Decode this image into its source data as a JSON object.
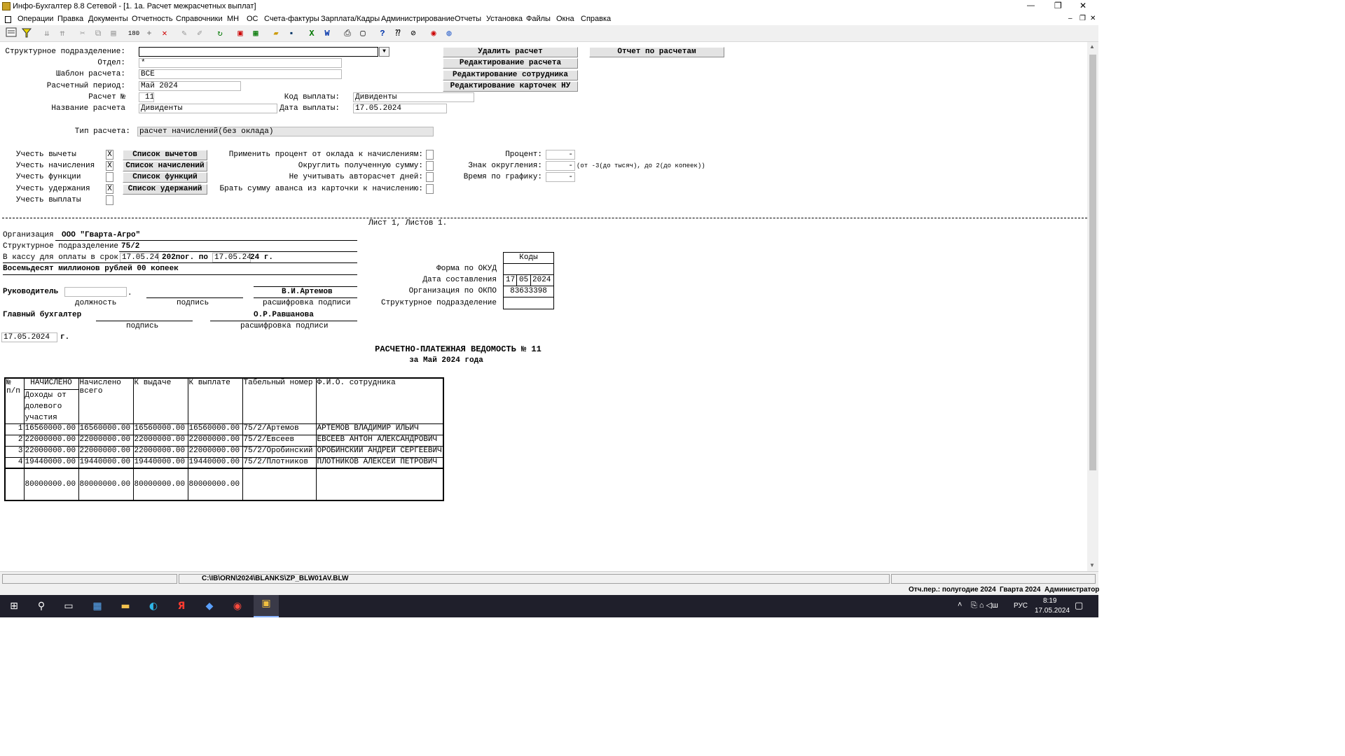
{
  "window": {
    "title": "Инфо-Бухгалтер 8.8 Сетевой - [1. 1а. Расчет межрасчетных выплат]",
    "minimize": "—",
    "restore": "❐",
    "close": "✕"
  },
  "menu": [
    "Операции",
    "Правка",
    "Документы",
    "Отчетность",
    "Справочники",
    "МН",
    "ОС",
    "Счета-фактуры",
    "Зарплата/Кадры",
    "Администрирование",
    "Отчеты",
    "Установка",
    "Файлы",
    "Окна",
    "Справка"
  ],
  "form": {
    "struct_label": "Структурное подразделение:",
    "struct_value": "",
    "otdel_label": "Отдел:",
    "otdel_value": "*",
    "template_label": "Шаблон расчета:",
    "template_value": "ВСЕ",
    "period_label": "Расчетный период:",
    "period_value": "Май 2024",
    "calc_no_label": "Расчет №",
    "calc_no_value": "11",
    "code_label": "Код выплаты:",
    "code_value": "Дивиденты",
    "calc_name_label": "Название расчета",
    "calc_name_value": "Дивиденты",
    "pay_date_label": "Дата выплаты:",
    "pay_date_value": "17.05.2024",
    "type_label": "Тип расчета:",
    "type_value": "расчет начислений(без оклада)"
  },
  "buttons": {
    "delete": "Удалить расчет",
    "report": "Отчет по расчетам",
    "edit_calc": "Редактирование расчета",
    "edit_emp": "Редактирование сотрудника",
    "edit_cards": "Редактирование карточек НУ"
  },
  "options": {
    "deductions": {
      "label": "Учесть вычеты",
      "checked": "X",
      "button": "Список вычетов"
    },
    "accruals": {
      "label": "Учесть начисления",
      "checked": "X",
      "button": "Список начислений"
    },
    "functions": {
      "label": "Учесть функции",
      "checked": "",
      "button": "Список функций"
    },
    "withholdings": {
      "label": "Учесть удержания",
      "checked": "X",
      "button": "Список удержаний"
    },
    "payments": {
      "label": "Учесть выплаты",
      "checked": ""
    },
    "apply_percent": "Применить процент от оклада к начислениям:",
    "round_sum": "Округлить полученную сумму:",
    "no_autocalc": "Не учитывать авторасчет дней:",
    "take_advance": "Брать сумму аванса из карточки к начислению:",
    "percent_label": "Процент:",
    "percent_value": "-",
    "round_sign_label": "Знак округления:",
    "round_sign_value": "-",
    "round_hint": "(от -3(до тысяч), до 2(до копеек))",
    "schedule_label": "Время по графику:",
    "schedule_value": "-"
  },
  "doc": {
    "sheet": "Лист 1, Листов 1.",
    "org_label": "Организация",
    "org_value": "ООО \"Гварта-Агро\"",
    "struct_label": "Структурное подразделение",
    "struct_value": "75/2",
    "cash_label": "В кассу для оплаты в срок",
    "cash_from": "17.05.24",
    "cash_mid": "202пог. по",
    "cash_to": "17.05.24",
    "cash_end": "24 г.",
    "sum_words": "Восемьдесят миллионов рублей 00 копеек",
    "head_label": "Руководитель",
    "head_name": "В.И.Артемов",
    "cap_position": "должность",
    "cap_signature": "подпись",
    "cap_decode": "расшифровка подписи",
    "chief_label": "Главный бухгалтер",
    "chief_name": "О.Р.Равшанова",
    "cap_signature2": "подпись",
    "cap_decode2": "расшифровка подписи",
    "date_value": "17.05.2024",
    "date_suffix": "г.",
    "codes_header": "Коды",
    "okud_label": "Форма по ОКУД",
    "comp_date_label": "Дата составления",
    "comp_day": "17",
    "comp_month": "05",
    "comp_year": "2024",
    "okpo_label": "Организация по ОКПО",
    "okpo_value": "83633398",
    "struct_code_label": "Структурное подразделение",
    "title": "РАСЧЕТНО-ПЛАТЕЖНАЯ ВЕДОМОСТЬ № 11",
    "subtitle": "за Май 2024 года"
  },
  "table": {
    "headers": {
      "no": "№\nп/п",
      "accrued": "НАЧИСЛЕНО",
      "accrued_sub": "Доходы от\nдолевого\nучастия",
      "total": "Начислено\nвсего",
      "to_issue": "К выдаче",
      "to_pay": "К выплате",
      "tab_no": "Табельный номер",
      "fio": "Ф.И.О. сотрудника"
    },
    "rows": [
      {
        "no": "1",
        "income": "16560000.00",
        "total": "16560000.00",
        "issue": "16560000.00",
        "pay": "16560000.00",
        "tab": "75/2/Артемов",
        "fio": "АРТЕМОВ ВЛАДИМИР ИЛЬИЧ"
      },
      {
        "no": "2",
        "income": "22000000.00",
        "total": "22000000.00",
        "issue": "22000000.00",
        "pay": "22000000.00",
        "tab": "75/2/Евсеев",
        "fio": "ЕВСЕЕВ АНТОН АЛЕКСАНДРОВИЧ"
      },
      {
        "no": "3",
        "income": "22000000.00",
        "total": "22000000.00",
        "issue": "22000000.00",
        "pay": "22000000.00",
        "tab": "75/2/Оробинский",
        "fio": "ОРОБИНСКИЙ АНДРЕЙ СЕРГЕЕВИЧ"
      },
      {
        "no": "4",
        "income": "19440000.00",
        "total": "19440000.00",
        "issue": "19440000.00",
        "pay": "19440000.00",
        "tab": "75/2/Плотников",
        "fio": "ПЛОТНИКОВ АЛЕКСЕЙ ПЕТРОВИЧ"
      }
    ],
    "totals": {
      "income": "80000000.00",
      "total": "80000000.00",
      "issue": "80000000.00",
      "pay": "80000000.00"
    }
  },
  "status": {
    "path": "C:\\IB\\ORN\\2024\\BLANKS\\ZP_BLW01AV.BLW",
    "period": "Отч.пер.: полугодие 2024",
    "org": "Гварта 2024",
    "user": "Администратор"
  },
  "taskbar": {
    "lang": "РУС",
    "time": "8:19",
    "date": "17.05.2024"
  }
}
